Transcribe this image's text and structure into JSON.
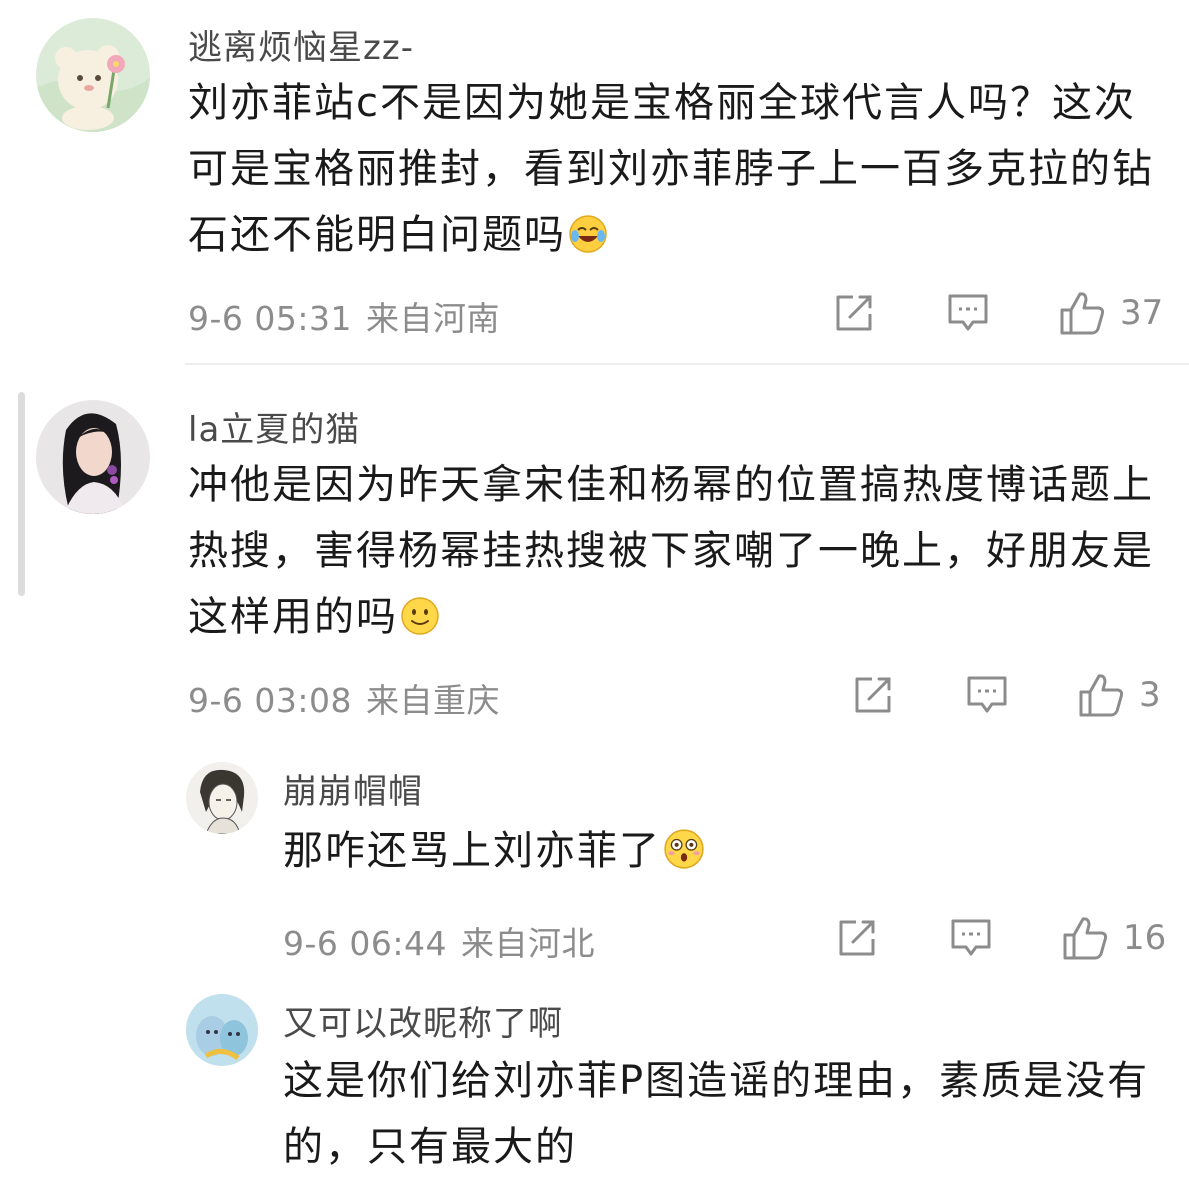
{
  "comments": [
    {
      "username": "逃离烦恼星zz-",
      "text": "刘亦菲站c不是因为她是宝格丽全球代言人吗？这次可是宝格丽推封，看到刘亦菲脖子上一百多克拉的钻石还不能明白问题吗",
      "emoji": "laughing-tears-emoji",
      "time": "9-6 05:31",
      "location": "来自河南",
      "likes": "37",
      "avatar": "bear-with-flower-avatar"
    },
    {
      "username": "la立夏的猫",
      "text": "冲他是因为昨天拿宋佳和杨幂的位置搞热度博话题上热搜，害得杨幂挂热搜被下家嘲了一晚上，好朋友是这样用的吗",
      "emoji": "smile-emoji",
      "time": "9-6 03:08",
      "location": "来自重庆",
      "likes": "3",
      "avatar": "woman-portrait-avatar"
    },
    {
      "username": "崩崩帽帽",
      "text": "那咋还骂上刘亦菲了",
      "emoji": "shocked-emoji",
      "time": "9-6 06:44",
      "location": "来自河北",
      "likes": "16",
      "avatar": "sketch-character-avatar"
    },
    {
      "username": "又可以改昵称了啊",
      "text": "这是你们给刘亦菲P图造谣的理由，素质是没有的，只有最大的",
      "emoji": "",
      "time": "",
      "location": "",
      "likes": "",
      "avatar": "cartoon-cats-avatar"
    }
  ],
  "icons": {
    "share": "share-icon",
    "reply": "comment-icon",
    "like": "thumbs-up-icon"
  },
  "colors": {
    "text": "#1a1a1a",
    "username": "#4a4a4a",
    "meta": "#8c8c8c",
    "divider": "#eeeeee"
  }
}
